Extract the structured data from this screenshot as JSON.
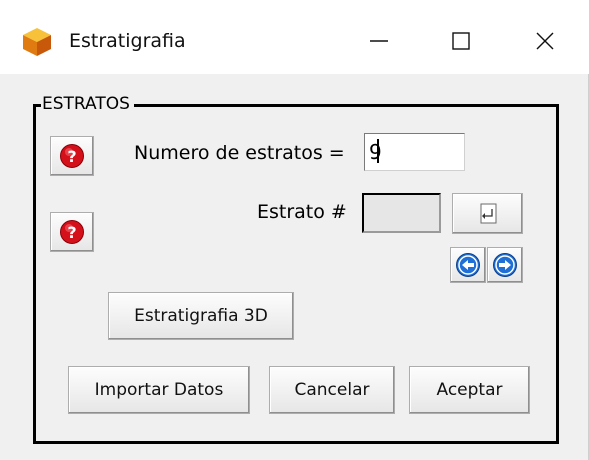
{
  "window": {
    "title": "Estratigrafia",
    "icon": "orange-cube-icon",
    "controls": [
      "minimize",
      "maximize",
      "close"
    ]
  },
  "group": {
    "legend": "ESTRATOS"
  },
  "fields": {
    "num_estratos_label": "Numero de estratos =",
    "num_estratos_value": "9",
    "estrato_label": "Estrato #",
    "estrato_value": ""
  },
  "buttons": {
    "help_icon": "question-icon",
    "enter_icon": "enter-icon",
    "prev_icon": "arrow-left-icon",
    "next_icon": "arrow-right-icon",
    "estratigrafia3d": "Estratigrafia 3D",
    "importar": "Importar Datos",
    "cancelar": "Cancelar",
    "aceptar": "Aceptar"
  },
  "colors": {
    "help_red": "#d4101a",
    "nav_blue": "#1f6fd6"
  }
}
